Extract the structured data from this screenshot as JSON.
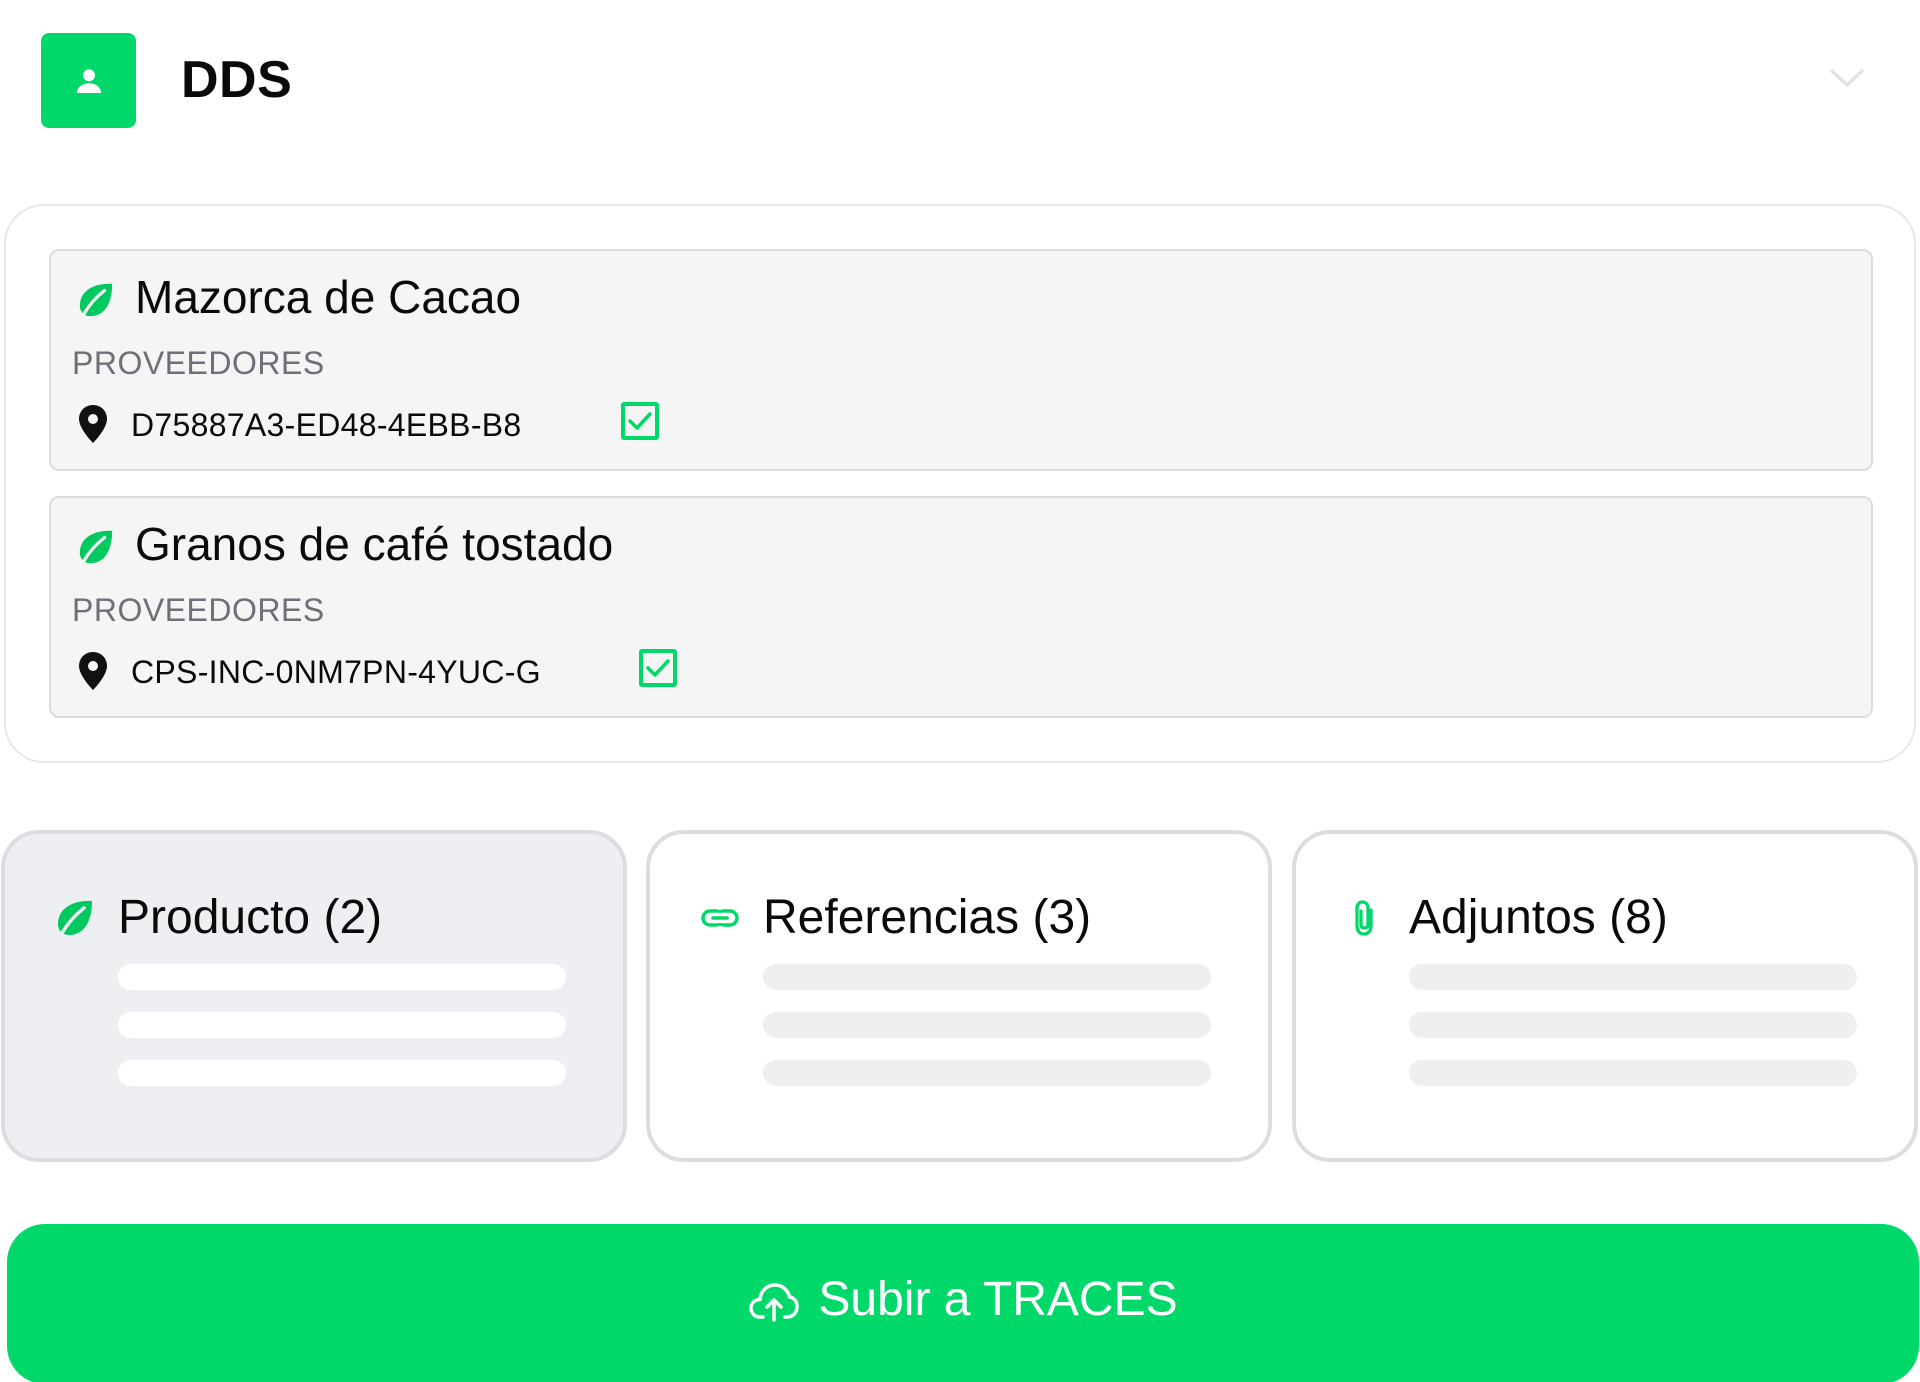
{
  "colors": {
    "accent": "#00d96a",
    "muted_text": "#6d7078",
    "card_bg": "#f5f5f5"
  },
  "header": {
    "title": "DDS",
    "avatar_icon": "user-icon",
    "toggle_icon": "chevron-down-icon"
  },
  "products": [
    {
      "name": "Mazorca de Cacao",
      "icon": "leaf-icon",
      "section_label": "PROVEEDORES",
      "supplier": {
        "code": "D75887A3-ED48-4EBB-B8",
        "icon": "map-pin-icon",
        "checked": true
      }
    },
    {
      "name": "Granos de café tostado",
      "icon": "leaf-icon",
      "section_label": "PROVEEDORES",
      "supplier": {
        "code": "CPS-INC-0NM7PN-4YUC-G",
        "icon": "map-pin-icon",
        "checked": true
      }
    }
  ],
  "summary_cards": [
    {
      "label": "Producto (2)",
      "icon": "leaf-icon",
      "selected": true
    },
    {
      "label": "Referencias (3)",
      "icon": "link-icon",
      "selected": false
    },
    {
      "label": "Adjuntos (8)",
      "icon": "paperclip-icon",
      "selected": false
    }
  ],
  "upload_button": {
    "label": "Subir a TRACES",
    "icon": "cloud-upload-icon"
  }
}
